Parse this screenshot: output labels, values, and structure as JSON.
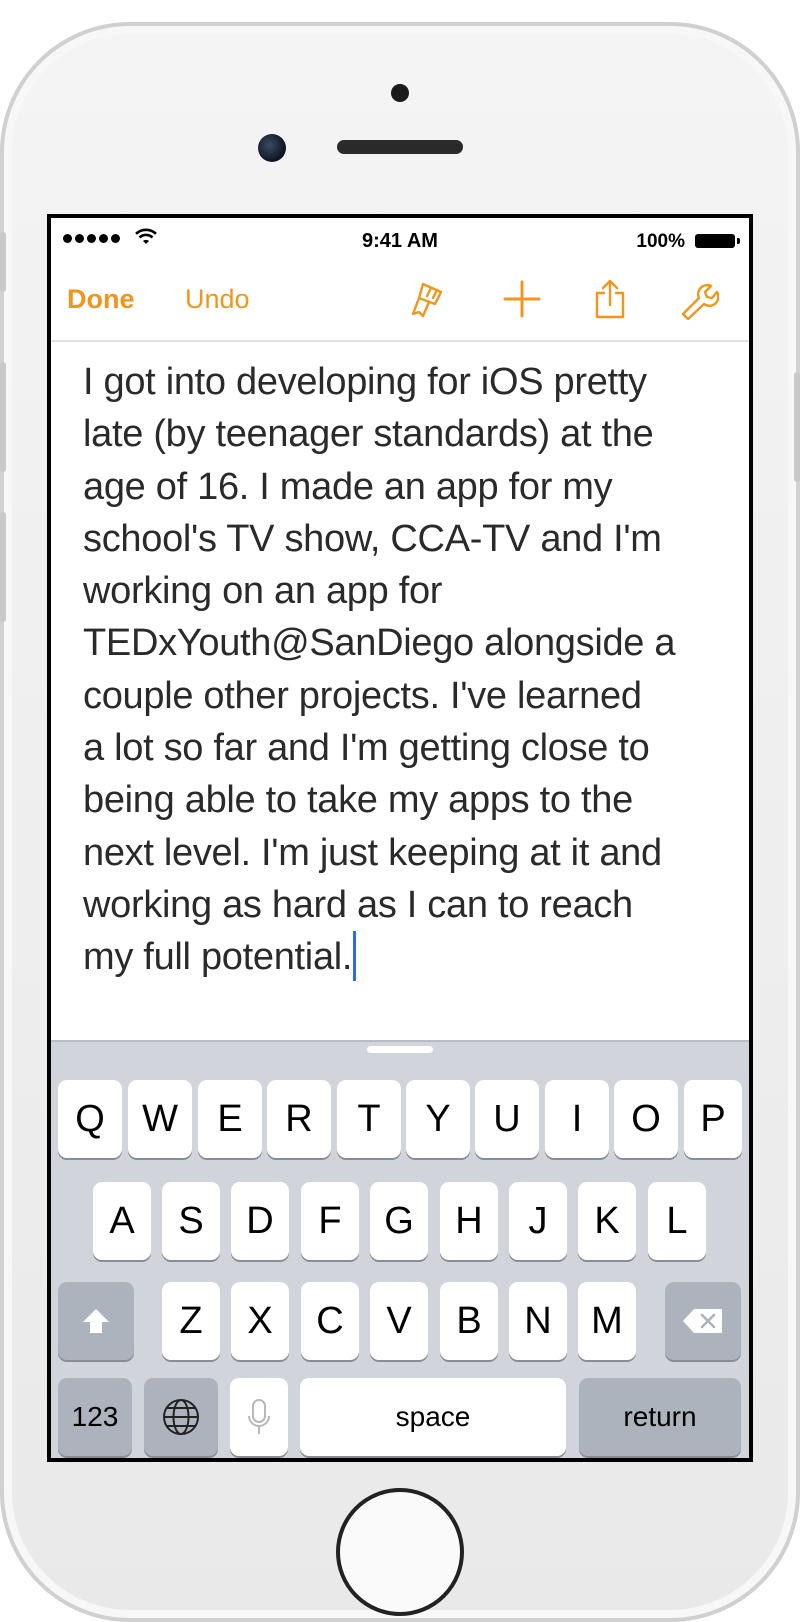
{
  "status_bar": {
    "time": "9:41 AM",
    "battery_percent": "100%"
  },
  "toolbar": {
    "done_label": "Done",
    "undo_label": "Undo",
    "icons": [
      "format-brush-icon",
      "plus-icon",
      "share-icon",
      "wrench-icon"
    ],
    "accent_color": "#f0961d"
  },
  "document": {
    "text": "I got into developing for iOS pretty\nlate (by teenager standards) at the\nage of 16. I made an app for my\nschool's TV show, CCA-TV and I'm\nworking on an app for\nTEDxYouth@SanDiego alongside a\ncouple other projects. I've learned\na lot so far and I'm getting close to\nbeing able to take my apps to the\nnext level. I'm just keeping at it and\nworking as hard as I can to reach\nmy full potential."
  },
  "keyboard": {
    "row1": [
      "Q",
      "W",
      "E",
      "R",
      "T",
      "Y",
      "U",
      "I",
      "O",
      "P"
    ],
    "row2": [
      "A",
      "S",
      "D",
      "F",
      "G",
      "H",
      "J",
      "K",
      "L"
    ],
    "row3": [
      "Z",
      "X",
      "C",
      "V",
      "B",
      "N",
      "M"
    ],
    "numbers_label": "123",
    "space_label": "space",
    "return_label": "return"
  }
}
